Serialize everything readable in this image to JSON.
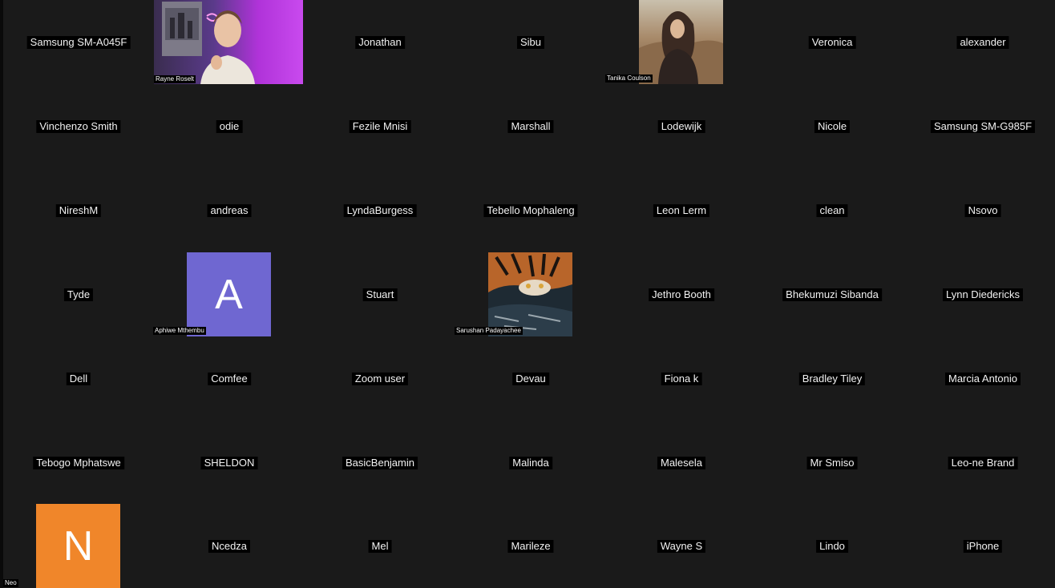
{
  "participants": [
    {
      "name": "Samsung SM-A045F"
    },
    {
      "name": "Rayne Roselt"
    },
    {
      "name": "Jonathan"
    },
    {
      "name": "Sibu"
    },
    {
      "name": "Tanika Coulson"
    },
    {
      "name": "Veronica"
    },
    {
      "name": "alexander"
    },
    {
      "name": "Vinchenzo Smith"
    },
    {
      "name": "odie"
    },
    {
      "name": "Fezile Mnisi"
    },
    {
      "name": "Marshall"
    },
    {
      "name": "Lodewijk"
    },
    {
      "name": "Nicole"
    },
    {
      "name": "Samsung SM-G985F"
    },
    {
      "name": "NireshM"
    },
    {
      "name": "andreas"
    },
    {
      "name": "LyndaBurgess"
    },
    {
      "name": "Tebello Mophaleng"
    },
    {
      "name": "Leon Lerm"
    },
    {
      "name": "clean"
    },
    {
      "name": "Nsovo"
    },
    {
      "name": "Tyde"
    },
    {
      "name": "Aphiwe Mthembu",
      "avatar_letter": "A"
    },
    {
      "name": "Stuart"
    },
    {
      "name": "Sarushan Padayachee"
    },
    {
      "name": "Jethro Booth"
    },
    {
      "name": "Bhekumuzi Sibanda"
    },
    {
      "name": "Lynn Diedericks"
    },
    {
      "name": "Dell"
    },
    {
      "name": "Comfee"
    },
    {
      "name": "Zoom user"
    },
    {
      "name": "Devau"
    },
    {
      "name": "Fiona k"
    },
    {
      "name": "Bradley Tiley"
    },
    {
      "name": "Marcia Antonio"
    },
    {
      "name": "Tebogo Mphatswe"
    },
    {
      "name": "SHELDON"
    },
    {
      "name": "BasicBenjamin"
    },
    {
      "name": "Malinda"
    },
    {
      "name": "Malesela"
    },
    {
      "name": "Mr Smiso"
    },
    {
      "name": "Leo-ne Brand"
    },
    {
      "name": "Neo",
      "avatar_letter": "N"
    },
    {
      "name": "Ncedza"
    },
    {
      "name": "Mel"
    },
    {
      "name": "Marileze"
    },
    {
      "name": "Wayne S"
    },
    {
      "name": "Lindo"
    },
    {
      "name": "iPhone"
    }
  ],
  "colors": {
    "background": "#1a1a1a",
    "avatar_a": "#6f67d1",
    "avatar_n": "#f0862a"
  }
}
